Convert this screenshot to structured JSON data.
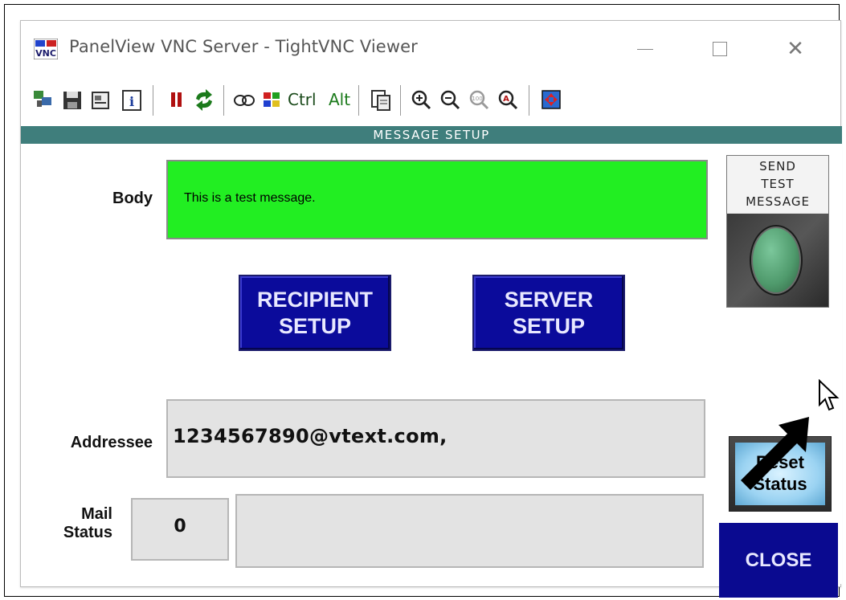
{
  "window": {
    "title": "PanelView VNC Server - TightVNC Viewer",
    "app_icon": "vnc-icon",
    "controls": [
      "minimize-icon",
      "maximize-icon",
      "close-icon"
    ]
  },
  "toolbar": {
    "icons": [
      "new-connection-icon",
      "save-icon",
      "options-icon",
      "info-icon",
      "pause-icon",
      "refresh-icon",
      "ctrl-alt-del-icon",
      "windows-key-icon",
      "ctrl-key",
      "alt-key",
      "clipboard-icon",
      "zoom-in-icon",
      "zoom-out-icon",
      "zoom-100-icon",
      "zoom-auto-icon",
      "fullscreen-icon"
    ],
    "ctrl_label": "Ctrl",
    "alt_label": "Alt"
  },
  "hmi": {
    "header": "MESSAGE SETUP",
    "body_label": "Body",
    "body_value": "This is a test message.",
    "send_label_line1": "SEND",
    "send_label_line2": "TEST",
    "send_label_line3": "MESSAGE",
    "recipient_line1": "RECIPIENT",
    "recipient_line2": "SETUP",
    "server_line1": "SERVER",
    "server_line2": "SETUP",
    "addressee_label": "Addressee",
    "addressee_value": "1234567890@vtext.com,",
    "mail_label_line1": "Mail",
    "mail_label_line2": "Status",
    "mail_status_code": "0",
    "mail_status_text": "",
    "reset_line1": "Reset",
    "reset_line2": "Status",
    "close_label": "CLOSE"
  },
  "colors": {
    "header_bar": "#3f7e7c",
    "body_field": "#22ee22",
    "nav_button": "#0b0b9b",
    "send_button": "#4f9a6c"
  }
}
